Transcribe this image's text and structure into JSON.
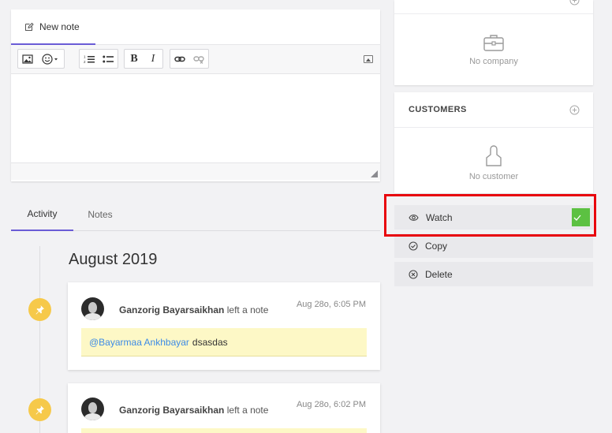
{
  "editor": {
    "tab_label": "New note",
    "toolbar": {
      "image": "image-icon",
      "emoji": "smiley-icon",
      "ordered_list": "numbered-list-icon",
      "bullet_list": "bulleted-list-icon",
      "bold": "B",
      "italic": "I",
      "link": "link-icon",
      "unlink": "unlink-icon",
      "collapse": "collapse-toolbar-icon"
    }
  },
  "tabs": [
    {
      "label": "Activity",
      "active": true
    },
    {
      "label": "Notes",
      "active": false
    }
  ],
  "timeline": {
    "month": "August 2019",
    "items": [
      {
        "author": "Ganzorig Bayarsaikhan",
        "action": "left a note",
        "time": "Aug 28o, 6:05 PM",
        "mention": "@Bayarmaa Ankhbayar",
        "text": "dsasdas"
      },
      {
        "author": "Ganzorig Bayarsaikhan",
        "action": "left a note",
        "time": "Aug 28o, 6:02 PM"
      }
    ]
  },
  "sidebar": {
    "company": {
      "empty_text": "No company"
    },
    "customers": {
      "title": "CUSTOMERS",
      "empty_text": "No customer"
    },
    "actions": [
      {
        "label": "Watch",
        "icon": "eye-icon",
        "checked": true
      },
      {
        "label": "Copy",
        "icon": "check-circle-icon"
      },
      {
        "label": "Delete",
        "icon": "x-circle-icon"
      }
    ]
  },
  "colors": {
    "accent": "#6a5cd6",
    "pin": "#f6c94a",
    "note_bg": "#fdf8c6",
    "mention": "#3d8be6",
    "check": "#5cc142",
    "highlight": "#e8050d"
  }
}
